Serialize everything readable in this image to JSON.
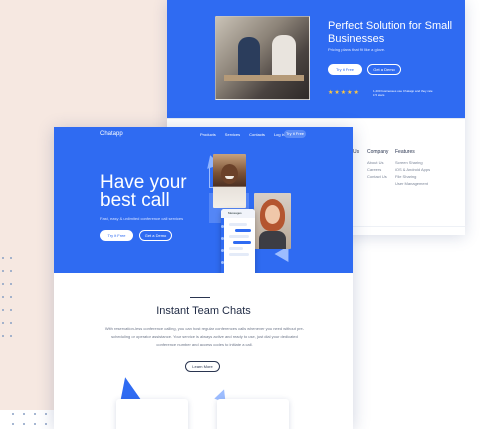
{
  "back": {
    "title": "Perfect Solution for Small Businesses",
    "subtitle": "Pricing plans that fit like a glove.",
    "btn_primary": "Try it Free",
    "btn_secondary": "Get a Demo",
    "stars": "★★★★★",
    "review_text": "1,200 businesses use Chatapp and they rate it 5 stars",
    "col_a": {
      "heading": "Us",
      "items": [
        "",
        "",
        ""
      ]
    },
    "col_b": {
      "heading": "Company",
      "items": [
        "About Us",
        "Careers",
        "Contact Us"
      ]
    },
    "col_c": {
      "heading": "Features",
      "items": [
        "Screen Sharing",
        "iOS & Android Apps",
        "File Sharing",
        "User Management"
      ]
    }
  },
  "front": {
    "logo": "Chatapp",
    "nav": [
      "Products",
      "Services",
      "Contacts",
      "Log in"
    ],
    "nav_cta": "Try it Free",
    "hero_title": "Have your best call",
    "hero_sub": "Fast, easy & unlimited conference call services",
    "btn_primary": "Try it Free",
    "btn_secondary": "Get a Demo",
    "phone_title": "Messages",
    "section_title": "Instant Team Chats",
    "section_text": "With reservation-less conference calling, you can host regular conferences calls whenever you need without pre-scheduling or operator assistance. Your service is always active and ready to use, just dial your dedicated conference number and access codes to initiate a call.",
    "learn_more": "Learn More"
  },
  "colors": {
    "brand_blue": "#2f6bf2",
    "peach_bg": "#f6e8e1",
    "star": "#ffc940"
  }
}
